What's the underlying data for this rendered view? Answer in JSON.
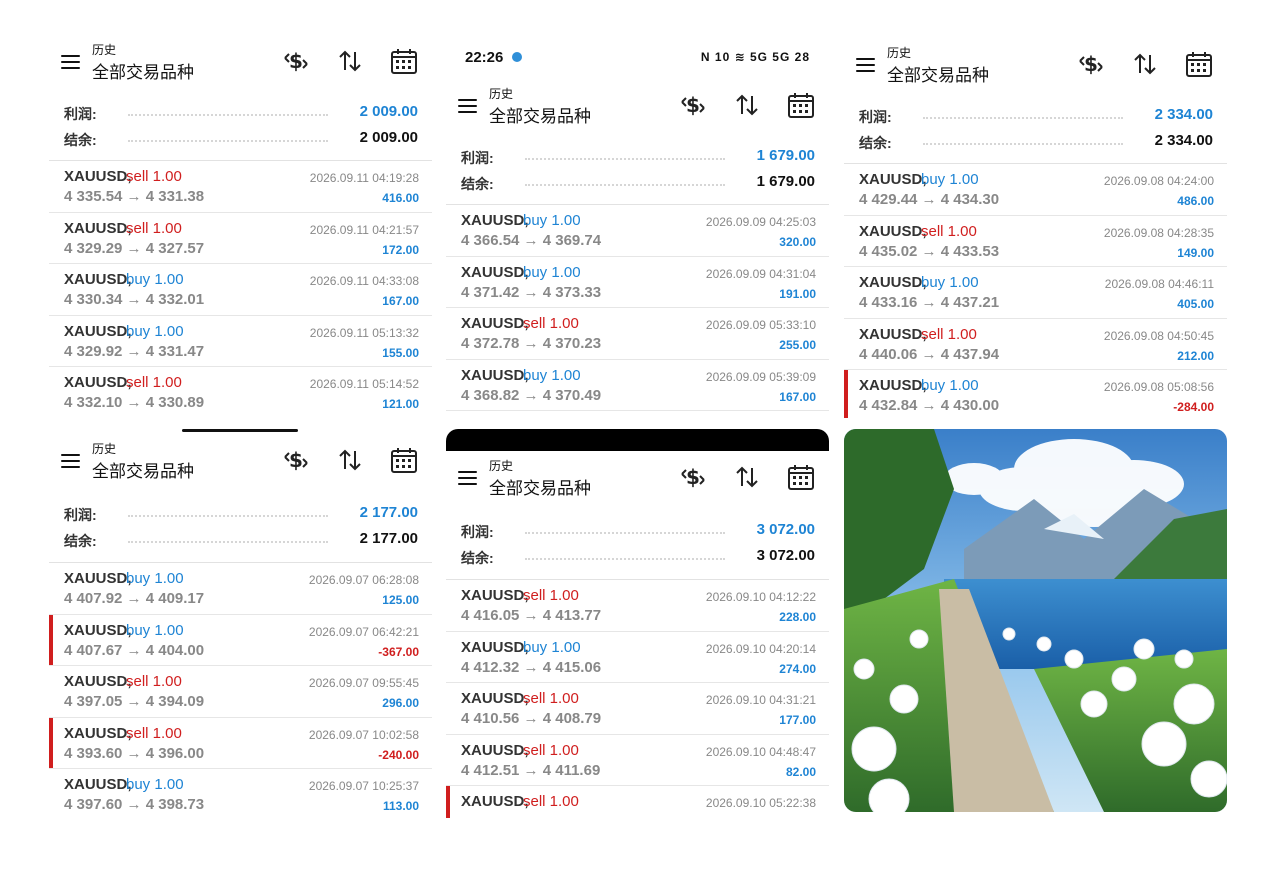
{
  "status_bar": {
    "time": "22:26",
    "icons": "N 10 ≋ 5G 5G 28"
  },
  "header": {
    "subtitle": "历史",
    "title": "全部交易品种",
    "icons": [
      "dollar-swap-icon",
      "sort-icon",
      "calendar-icon"
    ]
  },
  "labels": {
    "profit": "利润:",
    "balance": "结余:"
  },
  "colors": {
    "buy": "#1e84d4",
    "sell": "#d01e1e",
    "profit_positive": "#1e84d4",
    "profit_negative": "#d01e1e"
  },
  "panels": [
    {
      "id": "p1",
      "profit": "2 009.00",
      "balance": "2 009.00",
      "trades": [
        {
          "symbol": "XAUUSD,",
          "side": "sell",
          "volume": "sell 1.00",
          "prices": "4 335.54 → 4 331.38",
          "time": "2026.09.11 04:19:28",
          "profit": "416.00"
        },
        {
          "symbol": "XAUUSD,",
          "side": "sell",
          "volume": "sell 1.00",
          "prices": "4 329.29 → 4 327.57",
          "time": "2026.09.11 04:21:57",
          "profit": "172.00"
        },
        {
          "symbol": "XAUUSD,",
          "side": "buy",
          "volume": "buy 1.00",
          "prices": "4 330.34 → 4 332.01",
          "time": "2026.09.11 04:33:08",
          "profit": "167.00"
        },
        {
          "symbol": "XAUUSD,",
          "side": "buy",
          "volume": "buy 1.00",
          "prices": "4 329.92 → 4 331.47",
          "time": "2026.09.11 05:13:32",
          "profit": "155.00"
        },
        {
          "symbol": "XAUUSD,",
          "side": "sell",
          "volume": "sell 1.00",
          "prices": "4 332.10 → 4 330.89",
          "time": "2026.09.11 05:14:52",
          "profit": "121.00"
        }
      ]
    },
    {
      "id": "p2",
      "profit": "1 679.00",
      "balance": "1 679.00",
      "trades": [
        {
          "symbol": "XAUUSD,",
          "side": "buy",
          "volume": "buy 1.00",
          "prices": "4 366.54 → 4 369.74",
          "time": "2026.09.09 04:25:03",
          "profit": "320.00"
        },
        {
          "symbol": "XAUUSD,",
          "side": "buy",
          "volume": "buy 1.00",
          "prices": "4 371.42 → 4 373.33",
          "time": "2026.09.09 04:31:04",
          "profit": "191.00"
        },
        {
          "symbol": "XAUUSD,",
          "side": "sell",
          "volume": "sell 1.00",
          "prices": "4 372.78 → 4 370.23",
          "time": "2026.09.09 05:33:10",
          "profit": "255.00"
        },
        {
          "symbol": "XAUUSD,",
          "side": "buy",
          "volume": "buy 1.00",
          "prices": "4 368.82 → 4 370.49",
          "time": "2026.09.09 05:39:09",
          "profit": "167.00"
        }
      ]
    },
    {
      "id": "p3",
      "profit": "2 334.00",
      "balance": "2 334.00",
      "trades": [
        {
          "symbol": "XAUUSD,",
          "side": "buy",
          "volume": "buy 1.00",
          "prices": "4 429.44 → 4 434.30",
          "time": "2026.09.08 04:24:00",
          "profit": "486.00"
        },
        {
          "symbol": "XAUUSD,",
          "side": "sell",
          "volume": "sell 1.00",
          "prices": "4 435.02 → 4 433.53",
          "time": "2026.09.08 04:28:35",
          "profit": "149.00"
        },
        {
          "symbol": "XAUUSD,",
          "side": "buy",
          "volume": "buy 1.00",
          "prices": "4 433.16 → 4 437.21",
          "time": "2026.09.08 04:46:11",
          "profit": "405.00"
        },
        {
          "symbol": "XAUUSD,",
          "side": "sell",
          "volume": "sell 1.00",
          "prices": "4 440.06 → 4 437.94",
          "time": "2026.09.08 04:50:45",
          "profit": "212.00"
        },
        {
          "symbol": "XAUUSD,",
          "side": "buy",
          "volume": "buy 1.00",
          "prices": "4 432.84 → 4 430.00",
          "time": "2026.09.08 05:08:56",
          "profit": "-284.00"
        }
      ]
    },
    {
      "id": "p4",
      "profit": "2 177.00",
      "balance": "2 177.00",
      "trades": [
        {
          "symbol": "XAUUSD,",
          "side": "buy",
          "volume": "buy 1.00",
          "prices": "4 407.92 → 4 409.17",
          "time": "2026.09.07 06:28:08",
          "profit": "125.00"
        },
        {
          "symbol": "XAUUSD,",
          "side": "buy",
          "volume": "buy 1.00",
          "prices": "4 407.67 → 4 404.00",
          "time": "2026.09.07 06:42:21",
          "profit": "-367.00"
        },
        {
          "symbol": "XAUUSD,",
          "side": "sell",
          "volume": "sell 1.00",
          "prices": "4 397.05 → 4 394.09",
          "time": "2026.09.07 09:55:45",
          "profit": "296.00"
        },
        {
          "symbol": "XAUUSD,",
          "side": "sell",
          "volume": "sell 1.00",
          "prices": "4 393.60 → 4 396.00",
          "time": "2026.09.07 10:02:58",
          "profit": "-240.00"
        },
        {
          "symbol": "XAUUSD,",
          "side": "buy",
          "volume": "buy 1.00",
          "prices": "4 397.60 → 4 398.73",
          "time": "2026.09.07 10:25:37",
          "profit": "113.00"
        }
      ]
    },
    {
      "id": "p5",
      "profit": "3 072.00",
      "balance": "3 072.00",
      "trades": [
        {
          "symbol": "XAUUSD,",
          "side": "sell",
          "volume": "sell 1.00",
          "prices": "4 416.05 → 4 413.77",
          "time": "2026.09.10 04:12:22",
          "profit": "228.00"
        },
        {
          "symbol": "XAUUSD,",
          "side": "buy",
          "volume": "buy 1.00",
          "prices": "4 412.32 → 4 415.06",
          "time": "2026.09.10 04:20:14",
          "profit": "274.00"
        },
        {
          "symbol": "XAUUSD,",
          "side": "sell",
          "volume": "sell 1.00",
          "prices": "4 410.56 → 4 408.79",
          "time": "2026.09.10 04:31:21",
          "profit": "177.00"
        },
        {
          "symbol": "XAUUSD,",
          "side": "sell",
          "volume": "sell 1.00",
          "prices": "4 412.51 → 4 411.69",
          "time": "2026.09.10 04:48:47",
          "profit": "82.00"
        },
        {
          "symbol": "XAUUSD,",
          "side": "sell",
          "volume": "sell 1.00",
          "prices": "",
          "time": "2026.09.10 05:22:38",
          "profit": ""
        }
      ]
    }
  ]
}
